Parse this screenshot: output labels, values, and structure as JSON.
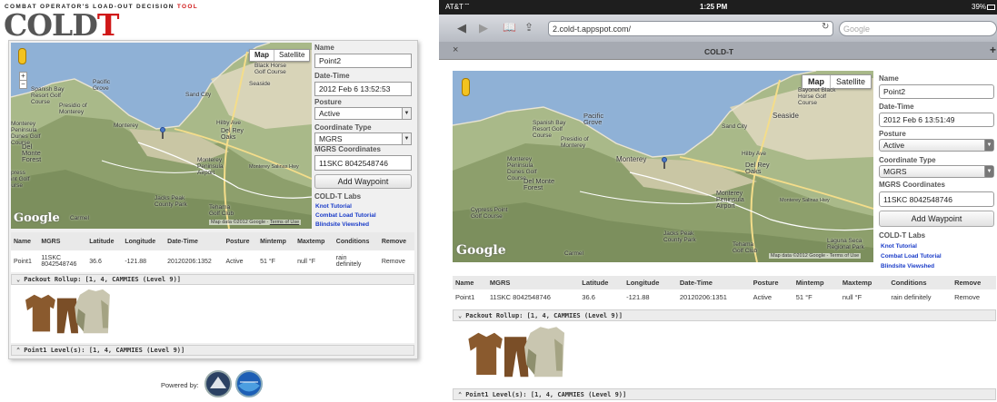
{
  "tagline_prefix": "COMBAT OPERATOR'S LOAD-OUT DECISION ",
  "tagline_accent": "TOOL",
  "logo_main": "COLD",
  "logo_accent": "T",
  "colors": {
    "accent_red": "#d01818",
    "link_blue": "#2255cc",
    "lab_blue": "#1a3cc8",
    "ios_bar": "#1e1e1e"
  },
  "map": {
    "mode_map": "Map",
    "mode_satellite": "Satellite",
    "google": "Google",
    "attribution_left": "Map data ©2012 Google - ",
    "terms": "Terms of Use",
    "attribution_right": "Map data ©2012 Google - Terms of Use",
    "zoom_in": "+",
    "zoom_out": "−",
    "places_left": [
      "Black Horse Golf Course",
      "Seaside",
      "Pacific Grove",
      "Spanish Bay Resort Golf Course",
      "Presidio of Monterey",
      "Sand City",
      "Monterey",
      "Monterey Peninsula Dunes Golf Course",
      "Del Monte Forest",
      "Del Rey Oaks",
      "Hilby Ave",
      "Monterey Peninsula Airport",
      "Cypress Point Golf Course",
      "Carmel",
      "Jacks Peak County Park",
      "Tehama Golf Club",
      "Monterey Salinas Hwy"
    ],
    "places_right": [
      "Bayonet Black Horse Golf Course",
      "Seaside",
      "Pacific Grove",
      "Spanish Bay Resort Golf Course",
      "Presidio of Monterey",
      "Sand City",
      "Monterey",
      "Monterey Peninsula Dunes Golf Course",
      "Del Monte Forest",
      "Del Rey Oaks",
      "Hilby Ave",
      "Monterey Peninsula Airport",
      "Cypress Point Golf Course",
      "Carmel",
      "Jacks Peak County Park",
      "Tehama Golf Club",
      "Laguna Seca Regional Park",
      "Monterey Salinas Hwy"
    ]
  },
  "form": {
    "name_label": "Name",
    "name_value": "Point2",
    "datetime_label": "Date-Time",
    "datetime_value_left": "2012 Feb 6 13:52:53",
    "datetime_value_right": "2012 Feb 6 13:51:49",
    "posture_label": "Posture",
    "posture_value": "Active",
    "coord_type_label": "Coordinate Type",
    "coord_type_value": "MGRS",
    "mgrs_label": "MGRS Coordinates",
    "mgrs_value": "11SKC 8042548746",
    "add_waypoint": "Add Waypoint",
    "labs_title": "COLD-T Labs",
    "labs_links": [
      "Knot Tutorial",
      "Combat Load Tutorial",
      "Blindsite Viewshed"
    ]
  },
  "table": {
    "headers": [
      "Name",
      "MGRS",
      "Latitude",
      "Longitude",
      "Date-Time",
      "Posture",
      "Mintemp",
      "Maxtemp",
      "Conditions",
      "Remove"
    ],
    "row_left": {
      "name": "Point1",
      "mgrs_a": "11SKC",
      "mgrs_b": "8042548746",
      "lat": "36.6",
      "lon": "-121.88",
      "dt": "20120206:1352",
      "posture": "Active",
      "min": "51 °F",
      "max": "null °F",
      "cond_a": "rain",
      "cond_b": "definitely",
      "remove": "Remove"
    },
    "row_right": {
      "name": "Point1",
      "mgrs": "11SKC 8042548746",
      "lat": "36.6",
      "lon": "-121.88",
      "dt": "20120206:1351",
      "posture": "Active",
      "min": "51 °F",
      "max": "null °F",
      "cond": "rain definitely",
      "remove": "Remove"
    }
  },
  "packout": "Packout Rollup: [1, 4, CAMMIES (Level 9)]",
  "levels": "Point1 Level(s): [1, 4, CAMMIES (Level 9)]",
  "powered_by": "Powered by:",
  "ios": {
    "carrier": "AT&T",
    "time": "1:25 PM",
    "battery": "39%",
    "url": "2.cold-t.appspot.com/",
    "search_placeholder": "Google",
    "tab_title": "COLD-T",
    "tab_close": "×",
    "tab_add": "+"
  }
}
